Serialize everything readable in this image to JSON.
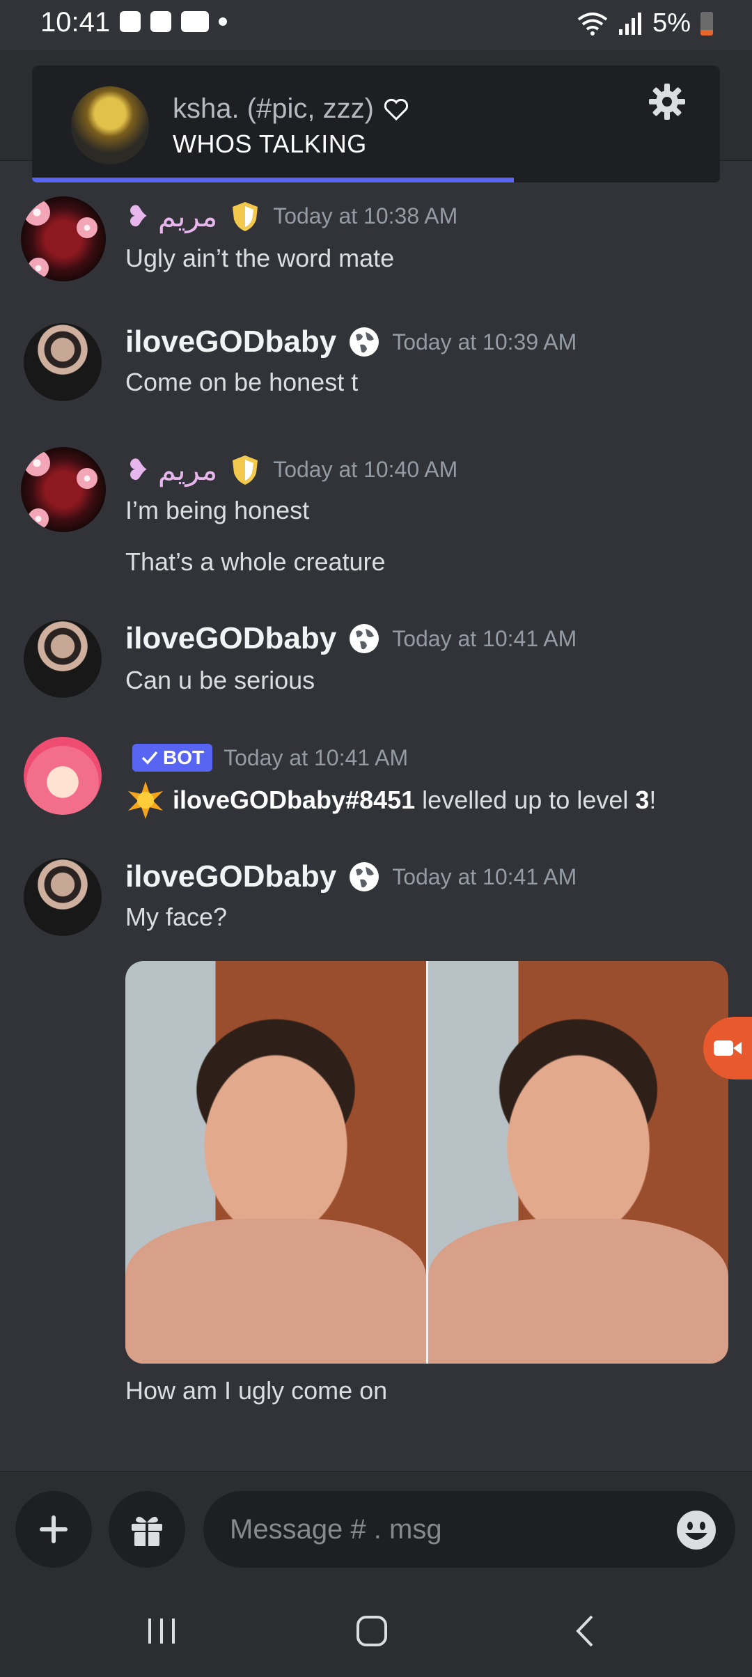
{
  "status_bar": {
    "time": "10:41",
    "battery": "5%"
  },
  "voice_call": {
    "channel_name": "ksha. (#pic, zzz)",
    "subtitle": "WHOS TALKING",
    "progress": 0.7
  },
  "messages": [
    {
      "author": "مريم",
      "author_prefix": "❥",
      "timestamp": "Today at 10:38 AM",
      "lines": [
        "Ugly ain’t the word mate"
      ]
    },
    {
      "author": "iloveGODbaby",
      "timestamp": "Today at 10:39 AM",
      "lines": [
        "Come on be honest t"
      ]
    },
    {
      "author": "مريم",
      "author_prefix": "❥",
      "timestamp": "Today at 10:40 AM",
      "lines": [
        "I’m being honest",
        "That’s a whole creature"
      ]
    },
    {
      "author": "iloveGODbaby",
      "timestamp": "Today at 10:41 AM",
      "lines": [
        "Can u be serious"
      ]
    },
    {
      "bot_badge": "BOT",
      "timestamp": "Today at 10:41 AM",
      "user_tag": "iloveGODbaby#8451",
      "text_mid": " levelled up to level ",
      "level": "3",
      "text_end": "!"
    },
    {
      "author": "iloveGODbaby",
      "timestamp": "Today at 10:41 AM",
      "lines": [
        "My face?",
        "How am I ugly come on"
      ]
    }
  ],
  "composer": {
    "placeholder": "Message # . msg"
  },
  "colors": {
    "accent": "#5865f2",
    "background": "#313338",
    "camera_button": "#e85a2d"
  }
}
